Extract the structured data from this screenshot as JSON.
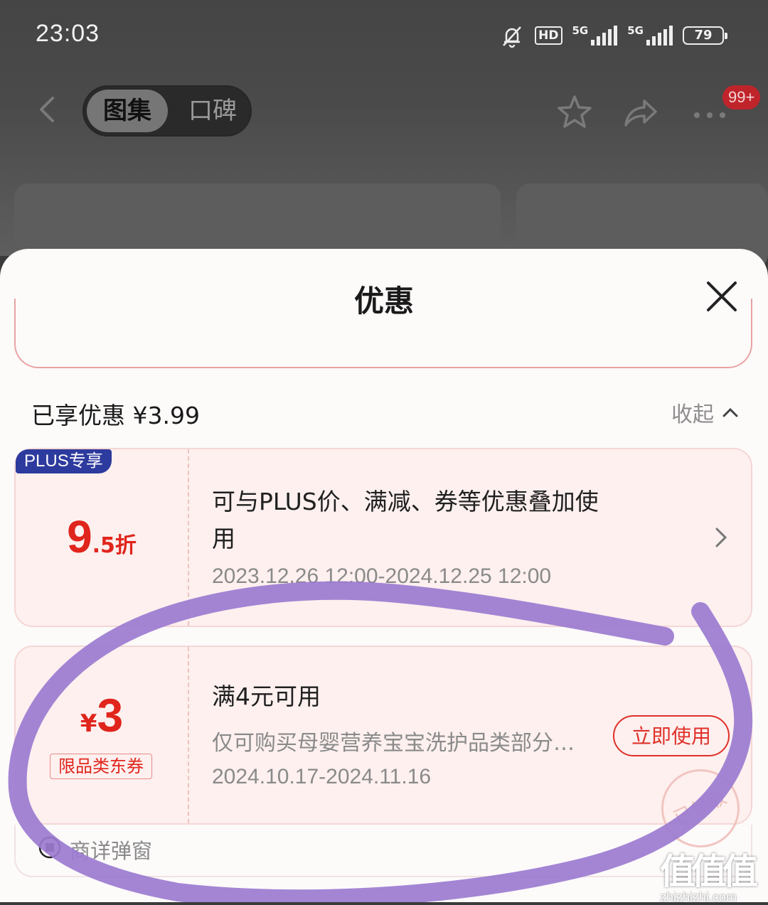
{
  "status_bar": {
    "time": "23:03",
    "network_1": "5G",
    "network_2": "5G",
    "hd": "HD",
    "battery": "79"
  },
  "nav": {
    "tabs": [
      {
        "label": "图集",
        "active": true
      },
      {
        "label": "口碑",
        "active": false
      }
    ],
    "badge": "99+"
  },
  "sheet": {
    "title": "优惠",
    "enjoyed_label": "已享优惠 ¥3.99",
    "collapse_label": "收起",
    "coupons": [
      {
        "tag": "PLUS专享",
        "value_big": "9",
        "value_small": ".5折",
        "title_line1": "可与PLUS价、满减、券等优惠叠加使",
        "title_line2": "用",
        "date": "2023.12.26 12:00-2024.12.25 12:00"
      },
      {
        "currency": "¥",
        "value_big": "3",
        "category_tag": "限品类东券",
        "title": "满4元可用",
        "desc": "仅可购买母婴营养宝宝洗护品类部分…",
        "date": "2024.10.17-2024.11.16",
        "button": "立即使用",
        "stamp": "已领取"
      }
    ],
    "popup_label": "商详弹窗"
  },
  "watermark": {
    "logo": "值值值",
    "url": "zhizhizhi.com"
  },
  "colors": {
    "accent_red": "#e0251c",
    "plus_blue": "#2d3a9e",
    "annotation_purple": "#9b7bd0"
  }
}
